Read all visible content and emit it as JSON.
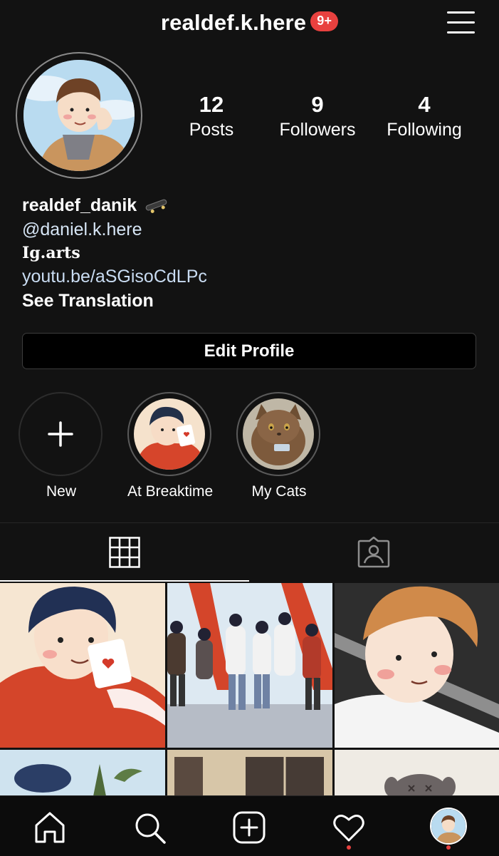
{
  "header": {
    "username": "realdef.k.here",
    "notification_badge": "9+"
  },
  "stats": [
    {
      "value": "12",
      "label": "Posts"
    },
    {
      "value": "9",
      "label": "Followers"
    },
    {
      "value": "4",
      "label": "Following"
    }
  ],
  "bio": {
    "name": "realdef_danik",
    "mention": "@daniel.k.here",
    "category": "Ig.arts",
    "link": "youtu.be/aSGisoCdLPc",
    "translation": "See Translation"
  },
  "edit_profile_label": "Edit Profile",
  "highlights": [
    {
      "label": "New"
    },
    {
      "label": "At Breaktime"
    },
    {
      "label": "My Cats"
    }
  ],
  "colors": {
    "background": "#121212",
    "badge": "#e8413f",
    "link": "#c9dcf2"
  },
  "icons": [
    "hamburger-menu-icon",
    "plus-icon",
    "grid-icon",
    "tagged-icon",
    "home-icon",
    "search-icon",
    "add-post-icon",
    "heart-icon"
  ]
}
